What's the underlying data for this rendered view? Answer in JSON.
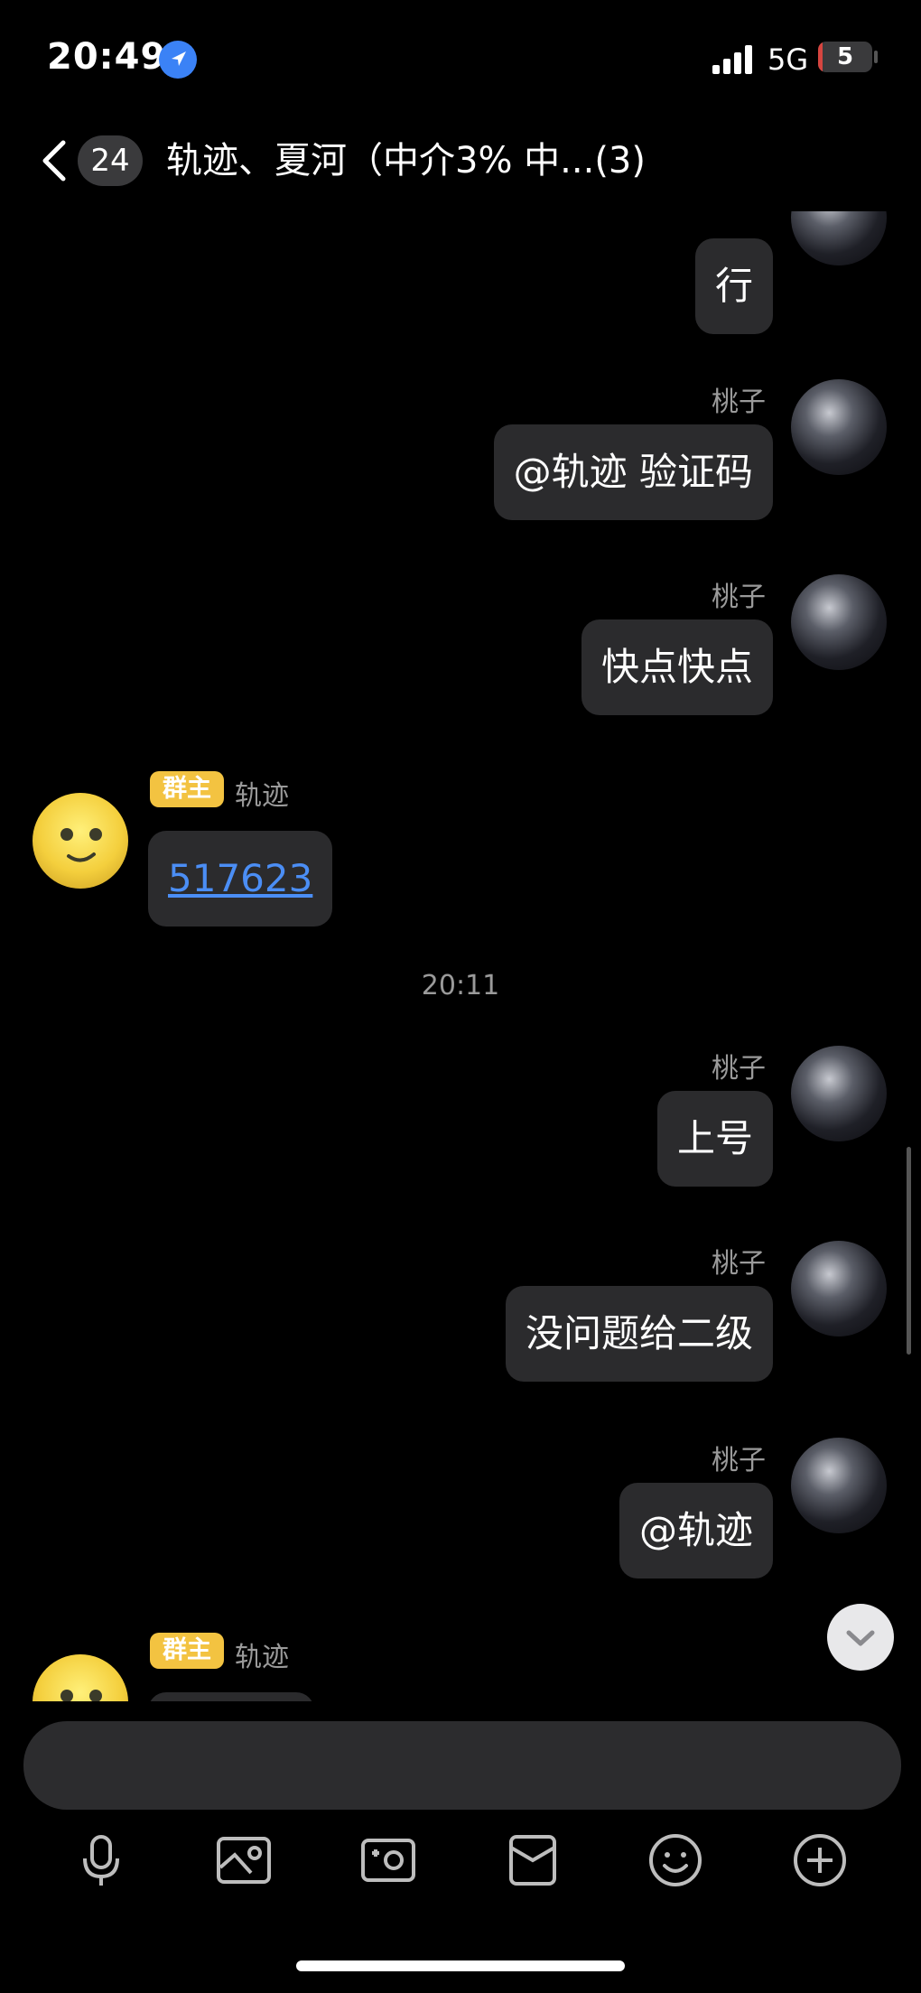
{
  "status_bar": {
    "time": "20:49",
    "network": "5G",
    "battery_level": "5",
    "battery_color": "#d64540"
  },
  "nav": {
    "back_icon": "chevron-left-icon",
    "unread_count": "24",
    "title": "轨迹、夏河（中介3% 中...(3)"
  },
  "messages": [
    {
      "side": "right",
      "sender": "",
      "text": "行"
    },
    {
      "side": "right",
      "sender": "桃子",
      "text": "@轨迹 验证码"
    },
    {
      "side": "right",
      "sender": "桃子",
      "text": "快点快点"
    },
    {
      "side": "left",
      "role_tag": "群主",
      "sender": "轨迹",
      "text": "517623"
    },
    {
      "timestamp": "20:11"
    },
    {
      "side": "right",
      "sender": "桃子",
      "text": "上号"
    },
    {
      "side": "right",
      "sender": "桃子",
      "text": "没问题给二级"
    },
    {
      "side": "right",
      "sender": "桃子",
      "text": "@轨迹"
    },
    {
      "side": "left",
      "role_tag": "群主",
      "sender": "轨迹",
      "text": ""
    }
  ],
  "input": {
    "placeholder": ""
  },
  "toolbar": [
    "microphone-icon",
    "image-icon",
    "camera-icon",
    "file-icon",
    "emoji-icon",
    "plus-circle-icon"
  ],
  "colors": {
    "background": "#000000",
    "bubble": "#2b2b2d",
    "role_tag": "#f3c341",
    "link": "#4b8ef5"
  }
}
